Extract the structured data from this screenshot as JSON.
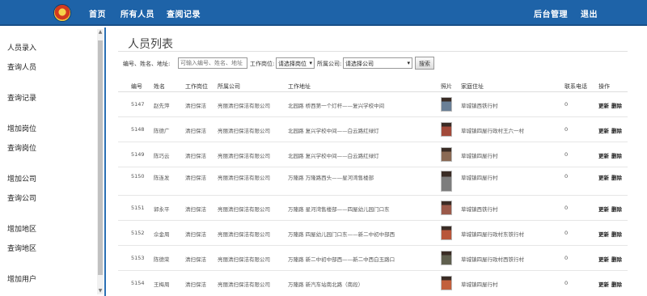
{
  "nav": {
    "home": "首页",
    "all_people": "所有人员",
    "query_records": "查阅记录",
    "admin": "后台管理",
    "logout": "退出"
  },
  "sidebar": {
    "items": [
      {
        "label": "人员录入"
      },
      {
        "label": "查询人员"
      },
      {
        "label": "查询记录"
      },
      {
        "label": "增加岗位"
      },
      {
        "label": "查询岗位"
      },
      {
        "label": "增加公司"
      },
      {
        "label": "查询公司"
      },
      {
        "label": "增加地区"
      },
      {
        "label": "查询地区"
      },
      {
        "label": "增加用户"
      }
    ]
  },
  "page": {
    "title": "人员列表"
  },
  "filters": {
    "search_label": "编号、姓名、地址:",
    "search_placeholder": "可输入编号、姓名、地址",
    "post_label": "工作岗位:",
    "post_value": "请选择岗位",
    "company_label": "所属公司:",
    "company_value": "请选择公司",
    "search_button": "搜索"
  },
  "table": {
    "headers": {
      "id": "编号",
      "name": "姓名",
      "post": "工作岗位",
      "company": "所属公司",
      "work_addr": "工作地址",
      "photo": "照片",
      "home_addr": "家庭住址",
      "phone": "联系电话",
      "ops": "操作"
    },
    "edit_label": "更新",
    "delete_label": "删除",
    "rows": [
      {
        "id": "5147",
        "name": "赵先萍",
        "post": "清扫保洁",
        "company": "亮丽清扫保洁有限公司",
        "work_addr": "北园路 桥西第一个灯杆——复兴学校中间",
        "home_addr": "草城镇西铁行村",
        "phone": "0",
        "photo_color": "#6a7f96"
      },
      {
        "id": "5148",
        "name": "陈德广",
        "post": "清扫保洁",
        "company": "亮丽清扫保洁有限公司",
        "work_addr": "北园路 复兴学校中间——白云路红绿灯",
        "home_addr": "草城镇四屋行政村王六一村",
        "phone": "0",
        "photo_color": "#a24a3a"
      },
      {
        "id": "5149",
        "name": "陈巧云",
        "post": "清扫保洁",
        "company": "亮丽清扫保洁有限公司",
        "work_addr": "北园路 复兴学校中间——白云路红绿灯",
        "home_addr": "草城镇四屋行村",
        "phone": "0",
        "photo_color": "#8a6a54"
      },
      {
        "id": "5150",
        "name": "陈连发",
        "post": "清扫保洁",
        "company": "亮丽清扫保洁有限公司",
        "work_addr": "万隆路 万隆路西头——星河湾售楼部",
        "home_addr": "草城镇四屋行村",
        "phone": "0",
        "photo_color": "#7d7d7d"
      },
      {
        "id": "5151",
        "name": "郭永平",
        "post": "清扫保洁",
        "company": "亮丽清扫保洁有限公司",
        "work_addr": "万隆路 星河湾售楼部——四屋幼儿园门口东",
        "home_addr": "草城镇西铁行村",
        "phone": "0",
        "photo_color": "#9b5a4a"
      },
      {
        "id": "5152",
        "name": "佘金周",
        "post": "清扫保洁",
        "company": "亮丽清扫保洁有限公司",
        "work_addr": "万隆路 四屋幼儿园门口东——新二中初中部西",
        "home_addr": "草城镇四屋行政村东铁行村",
        "phone": "0",
        "photo_color": "#b8563a"
      },
      {
        "id": "5153",
        "name": "陈德荣",
        "post": "清扫保洁",
        "company": "亮丽清扫保洁有限公司",
        "work_addr": "万隆路 新二中初中部西——新二中西白玉路口",
        "home_addr": "草城镇四屋行政村西铁行村",
        "phone": "0",
        "photo_color": "#5f5f4e"
      },
      {
        "id": "5154",
        "name": "王梅周",
        "post": "清扫保洁",
        "company": "亮丽清扫保洁有限公司",
        "work_addr": "万隆路 新汽车站南北路（南段）",
        "home_addr": "草城镇四屋行村",
        "phone": "0",
        "photo_color": "#c2603c"
      }
    ]
  },
  "colors": {
    "topbar": "#1e63a8",
    "sidebar_border": "#2a6fb3"
  },
  "icons": {
    "logo": "police-emblem-icon"
  }
}
